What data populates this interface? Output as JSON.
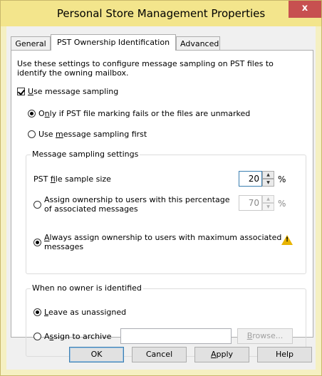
{
  "window": {
    "title": "Personal Store Management Properties",
    "close_glyph": "x"
  },
  "tabs": [
    {
      "label": "General"
    },
    {
      "label": "PST Ownership Identification"
    },
    {
      "label": "Advanced"
    }
  ],
  "intro": "Use these settings to configure message sampling on PST files to identify the owning mailbox.",
  "use_sampling": {
    "pre": "",
    "key": "U",
    "rest": "se message sampling"
  },
  "radio_only_if": {
    "pre": "O",
    "key": "n",
    "rest": "ly if PST file marking fails or the files are unmarked"
  },
  "radio_first": {
    "pre": "Use ",
    "key": "m",
    "rest": "essage sampling first"
  },
  "sampling_group": {
    "label": "Message sampling settings",
    "sample_size_pre": "PST ",
    "sample_size_key": "f",
    "sample_size_rest": "ile sample size",
    "sample_size_value": "20",
    "percent": "%",
    "assign_pct_line1": "Assign ownership to users with this percentage",
    "assign_pct_line2": "of associated messages",
    "assign_pct_value": "70",
    "assign_pct_percent": "%",
    "always_key": "A",
    "always_line1_rest": "lways assign ownership to users with maximum associated",
    "always_line2": "messages",
    "warn_glyph": "!"
  },
  "no_owner_group": {
    "label": "When no owner is identified",
    "leave_key": "L",
    "leave_rest": "eave as unassigned",
    "archive_pre": "A",
    "archive_key": "s",
    "archive_rest": "sign to archive",
    "archive_value": "",
    "browse_key": "B",
    "browse_rest": "rowse..."
  },
  "buttons": {
    "ok": "OK",
    "cancel": "Cancel",
    "apply_key": "A",
    "apply_rest": "pply",
    "help": "Help"
  }
}
